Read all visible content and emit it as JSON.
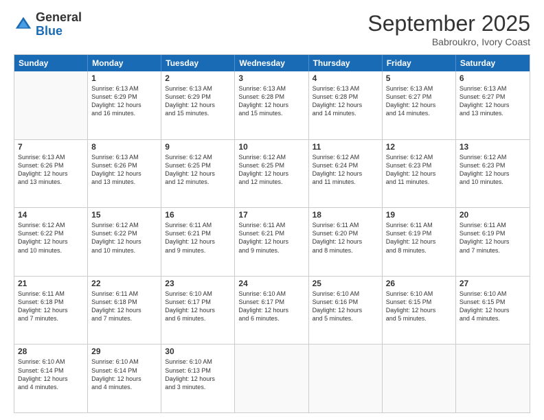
{
  "logo": {
    "general": "General",
    "blue": "Blue"
  },
  "header": {
    "month": "September 2025",
    "location": "Babroukro, Ivory Coast"
  },
  "days": [
    "Sunday",
    "Monday",
    "Tuesday",
    "Wednesday",
    "Thursday",
    "Friday",
    "Saturday"
  ],
  "weeks": [
    [
      {
        "day": "",
        "content": ""
      },
      {
        "day": "1",
        "content": "Sunrise: 6:13 AM\nSunset: 6:29 PM\nDaylight: 12 hours\nand 16 minutes."
      },
      {
        "day": "2",
        "content": "Sunrise: 6:13 AM\nSunset: 6:29 PM\nDaylight: 12 hours\nand 15 minutes."
      },
      {
        "day": "3",
        "content": "Sunrise: 6:13 AM\nSunset: 6:28 PM\nDaylight: 12 hours\nand 15 minutes."
      },
      {
        "day": "4",
        "content": "Sunrise: 6:13 AM\nSunset: 6:28 PM\nDaylight: 12 hours\nand 14 minutes."
      },
      {
        "day": "5",
        "content": "Sunrise: 6:13 AM\nSunset: 6:27 PM\nDaylight: 12 hours\nand 14 minutes."
      },
      {
        "day": "6",
        "content": "Sunrise: 6:13 AM\nSunset: 6:27 PM\nDaylight: 12 hours\nand 13 minutes."
      }
    ],
    [
      {
        "day": "7",
        "content": "Sunrise: 6:13 AM\nSunset: 6:26 PM\nDaylight: 12 hours\nand 13 minutes."
      },
      {
        "day": "8",
        "content": "Sunrise: 6:13 AM\nSunset: 6:26 PM\nDaylight: 12 hours\nand 13 minutes."
      },
      {
        "day": "9",
        "content": "Sunrise: 6:12 AM\nSunset: 6:25 PM\nDaylight: 12 hours\nand 12 minutes."
      },
      {
        "day": "10",
        "content": "Sunrise: 6:12 AM\nSunset: 6:25 PM\nDaylight: 12 hours\nand 12 minutes."
      },
      {
        "day": "11",
        "content": "Sunrise: 6:12 AM\nSunset: 6:24 PM\nDaylight: 12 hours\nand 11 minutes."
      },
      {
        "day": "12",
        "content": "Sunrise: 6:12 AM\nSunset: 6:23 PM\nDaylight: 12 hours\nand 11 minutes."
      },
      {
        "day": "13",
        "content": "Sunrise: 6:12 AM\nSunset: 6:23 PM\nDaylight: 12 hours\nand 10 minutes."
      }
    ],
    [
      {
        "day": "14",
        "content": "Sunrise: 6:12 AM\nSunset: 6:22 PM\nDaylight: 12 hours\nand 10 minutes."
      },
      {
        "day": "15",
        "content": "Sunrise: 6:12 AM\nSunset: 6:22 PM\nDaylight: 12 hours\nand 10 minutes."
      },
      {
        "day": "16",
        "content": "Sunrise: 6:11 AM\nSunset: 6:21 PM\nDaylight: 12 hours\nand 9 minutes."
      },
      {
        "day": "17",
        "content": "Sunrise: 6:11 AM\nSunset: 6:21 PM\nDaylight: 12 hours\nand 9 minutes."
      },
      {
        "day": "18",
        "content": "Sunrise: 6:11 AM\nSunset: 6:20 PM\nDaylight: 12 hours\nand 8 minutes."
      },
      {
        "day": "19",
        "content": "Sunrise: 6:11 AM\nSunset: 6:19 PM\nDaylight: 12 hours\nand 8 minutes."
      },
      {
        "day": "20",
        "content": "Sunrise: 6:11 AM\nSunset: 6:19 PM\nDaylight: 12 hours\nand 7 minutes."
      }
    ],
    [
      {
        "day": "21",
        "content": "Sunrise: 6:11 AM\nSunset: 6:18 PM\nDaylight: 12 hours\nand 7 minutes."
      },
      {
        "day": "22",
        "content": "Sunrise: 6:11 AM\nSunset: 6:18 PM\nDaylight: 12 hours\nand 7 minutes."
      },
      {
        "day": "23",
        "content": "Sunrise: 6:10 AM\nSunset: 6:17 PM\nDaylight: 12 hours\nand 6 minutes."
      },
      {
        "day": "24",
        "content": "Sunrise: 6:10 AM\nSunset: 6:17 PM\nDaylight: 12 hours\nand 6 minutes."
      },
      {
        "day": "25",
        "content": "Sunrise: 6:10 AM\nSunset: 6:16 PM\nDaylight: 12 hours\nand 5 minutes."
      },
      {
        "day": "26",
        "content": "Sunrise: 6:10 AM\nSunset: 6:15 PM\nDaylight: 12 hours\nand 5 minutes."
      },
      {
        "day": "27",
        "content": "Sunrise: 6:10 AM\nSunset: 6:15 PM\nDaylight: 12 hours\nand 4 minutes."
      }
    ],
    [
      {
        "day": "28",
        "content": "Sunrise: 6:10 AM\nSunset: 6:14 PM\nDaylight: 12 hours\nand 4 minutes."
      },
      {
        "day": "29",
        "content": "Sunrise: 6:10 AM\nSunset: 6:14 PM\nDaylight: 12 hours\nand 4 minutes."
      },
      {
        "day": "30",
        "content": "Sunrise: 6:10 AM\nSunset: 6:13 PM\nDaylight: 12 hours\nand 3 minutes."
      },
      {
        "day": "",
        "content": ""
      },
      {
        "day": "",
        "content": ""
      },
      {
        "day": "",
        "content": ""
      },
      {
        "day": "",
        "content": ""
      }
    ]
  ]
}
